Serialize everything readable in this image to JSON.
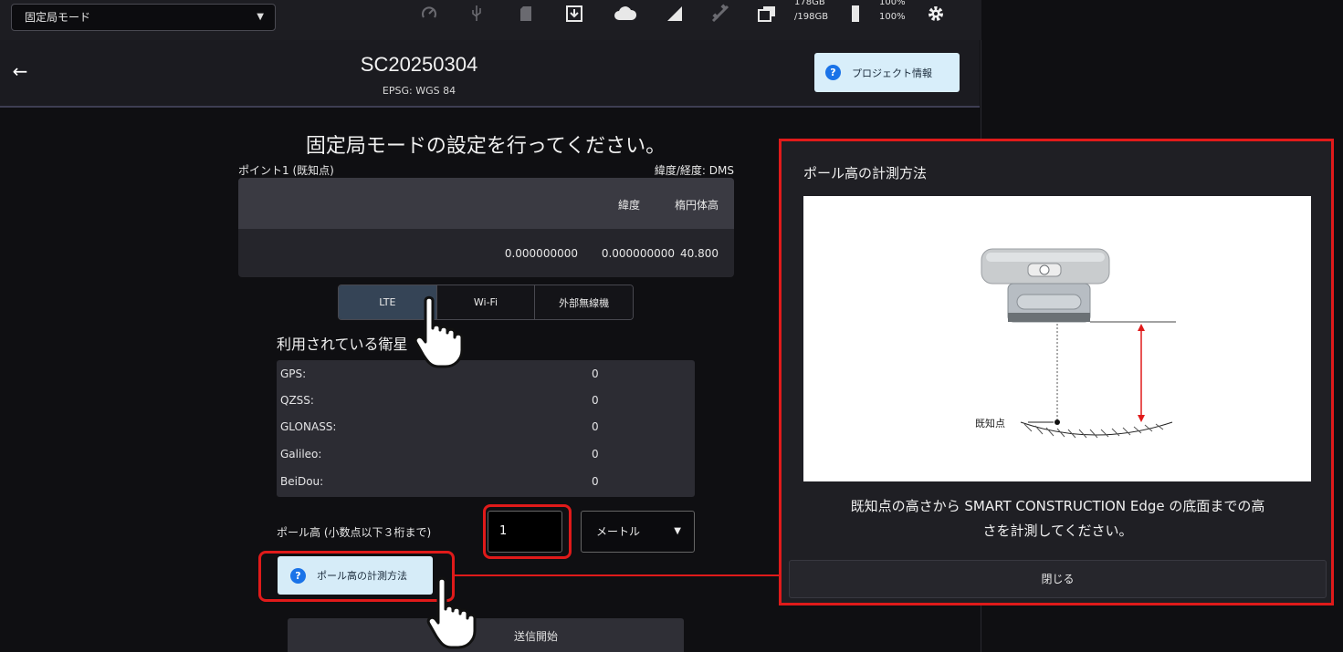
{
  "status_bar": {
    "mode_selected": "固定局モード",
    "storage_used": "178GB",
    "storage_total": "/198GB",
    "battery_pct_1": "100%",
    "battery_pct_2": "100%"
  },
  "header": {
    "project_title": "SC20250304",
    "epsg": "EPSG: WGS 84",
    "project_info_label": "プロジェクト情報"
  },
  "main": {
    "instruction": "固定局モードの設定を行ってください。",
    "point_label": "ポイント1 (既知点)",
    "coord_format": "緯度/経度: DMS",
    "coord_table": {
      "headers": [
        "緯度",
        "経度",
        "楕円体高"
      ],
      "values": [
        "0.000000000",
        "0.000000000",
        "40.800"
      ]
    },
    "comm_tabs": [
      "LTE",
      "Wi-Fi",
      "外部無線機"
    ],
    "satellites_heading": "利用されている衛星",
    "satellites": [
      {
        "name": "GPS:",
        "count": "0"
      },
      {
        "name": "QZSS:",
        "count": "0"
      },
      {
        "name": "GLONASS:",
        "count": "0"
      },
      {
        "name": "Galileo:",
        "count": "0"
      },
      {
        "name": "BeiDou:",
        "count": "0"
      }
    ],
    "pole_height_label": "ポール高 (小数点以下３桁まで)",
    "pole_height_value": "1",
    "unit_selected": "メートル",
    "measure_method_label": "ポール高の計測方法",
    "start_label": "送信開始"
  },
  "dialog": {
    "title": "ポール高の計測方法",
    "image_label": "既知点",
    "description_line1": "既知点の高さから SMART CONSTRUCTION Edge の底面までの高",
    "description_line2": "さを計測してください。",
    "close_label": "閉じる"
  },
  "colors": {
    "accent_red": "#e01a1a",
    "help_blue": "#1a73e8",
    "button_light": "#d6ecf8"
  }
}
